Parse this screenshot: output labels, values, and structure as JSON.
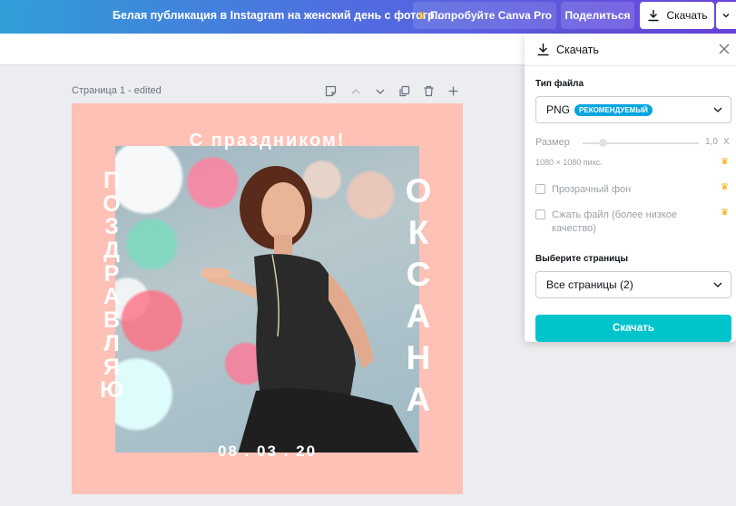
{
  "header": {
    "doc_title": "Белая публикация в Instagram на женский день с фотогр...",
    "try_pro_label": "Попробуйте Canva Pro",
    "share_label": "Поделиться",
    "download_label": "Скачать"
  },
  "page": {
    "label": "Страница 1 - edited"
  },
  "design": {
    "greeting": "С праздником!",
    "left_letters": [
      "П",
      "О",
      "З",
      "Д",
      "Р",
      "А",
      "В",
      "Л",
      "Я",
      "Ю"
    ],
    "right_letters": [
      "О",
      "К",
      "С",
      "А",
      "Н",
      "А"
    ],
    "date": "08 . 03 . 20",
    "background_color": "#ffc0b5"
  },
  "download_panel": {
    "title": "Скачать",
    "file_type_label": "Тип файла",
    "file_type_value": "PNG",
    "recommended_badge": "РЕКОМЕНДУЕМЫЙ",
    "size_label": "Размер",
    "size_value": "1,0",
    "size_multiplier": "X",
    "dimensions": "1080 × 1080 пикс.",
    "transparent_bg_label": "Прозрачный фон",
    "compress_label": "Сжать файл (более низкое качество)",
    "pages_label": "Выберите страницы",
    "pages_value": "Все страницы (2)",
    "download_button": "Скачать"
  },
  "colors": {
    "accent": "#00c4cc",
    "badge": "#00a5e2",
    "crown": "#ffc400"
  }
}
